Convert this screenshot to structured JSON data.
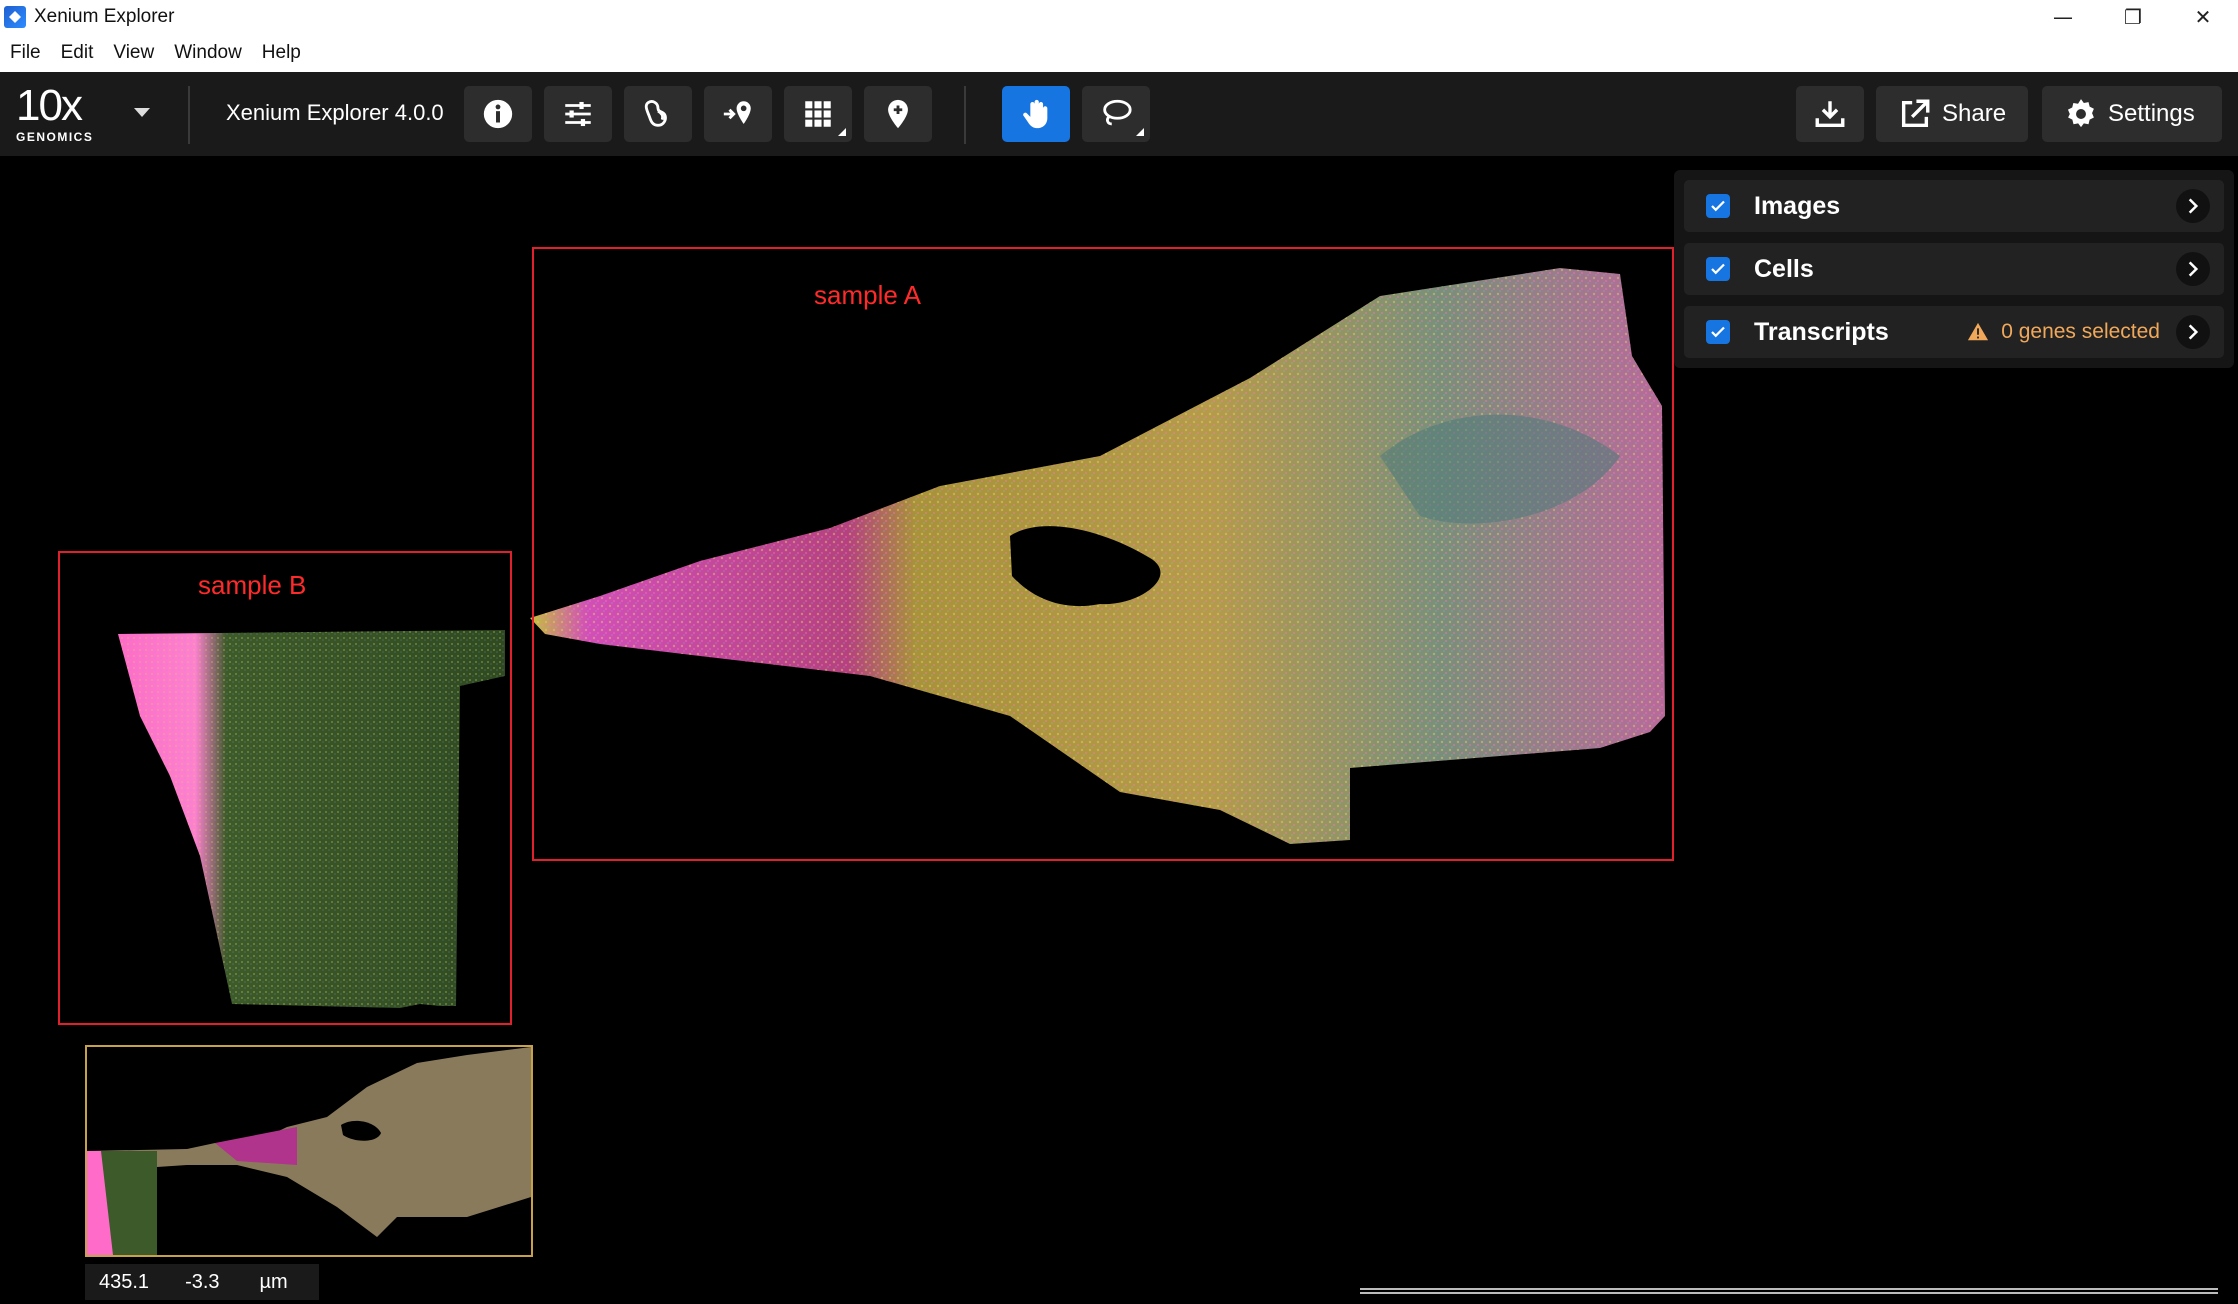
{
  "window": {
    "title": "Xenium Explorer"
  },
  "menu": {
    "items": [
      "File",
      "Edit",
      "View",
      "Window",
      "Help"
    ]
  },
  "toolbar": {
    "logo_main": "10x",
    "logo_sub": "GENOMICS",
    "product": "Xenium Explorer 4.0.0",
    "share_label": "Share",
    "settings_label": "Settings",
    "pan_tool_active": true
  },
  "samples": [
    {
      "label": "sample A"
    },
    {
      "label": "sample B"
    }
  ],
  "layers": [
    {
      "name": "Images",
      "checked": true,
      "warning": ""
    },
    {
      "name": "Cells",
      "checked": true,
      "warning": ""
    },
    {
      "name": "Transcripts",
      "checked": true,
      "warning": "0 genes selected"
    }
  ],
  "coordinates": {
    "x": "435.1",
    "y": "-3.3",
    "unit": "µm"
  },
  "colors": {
    "accent": "#1675e0",
    "sample_box": "#e0202a",
    "warning": "#f0a85a",
    "minimap_border": "#c8a24a"
  }
}
